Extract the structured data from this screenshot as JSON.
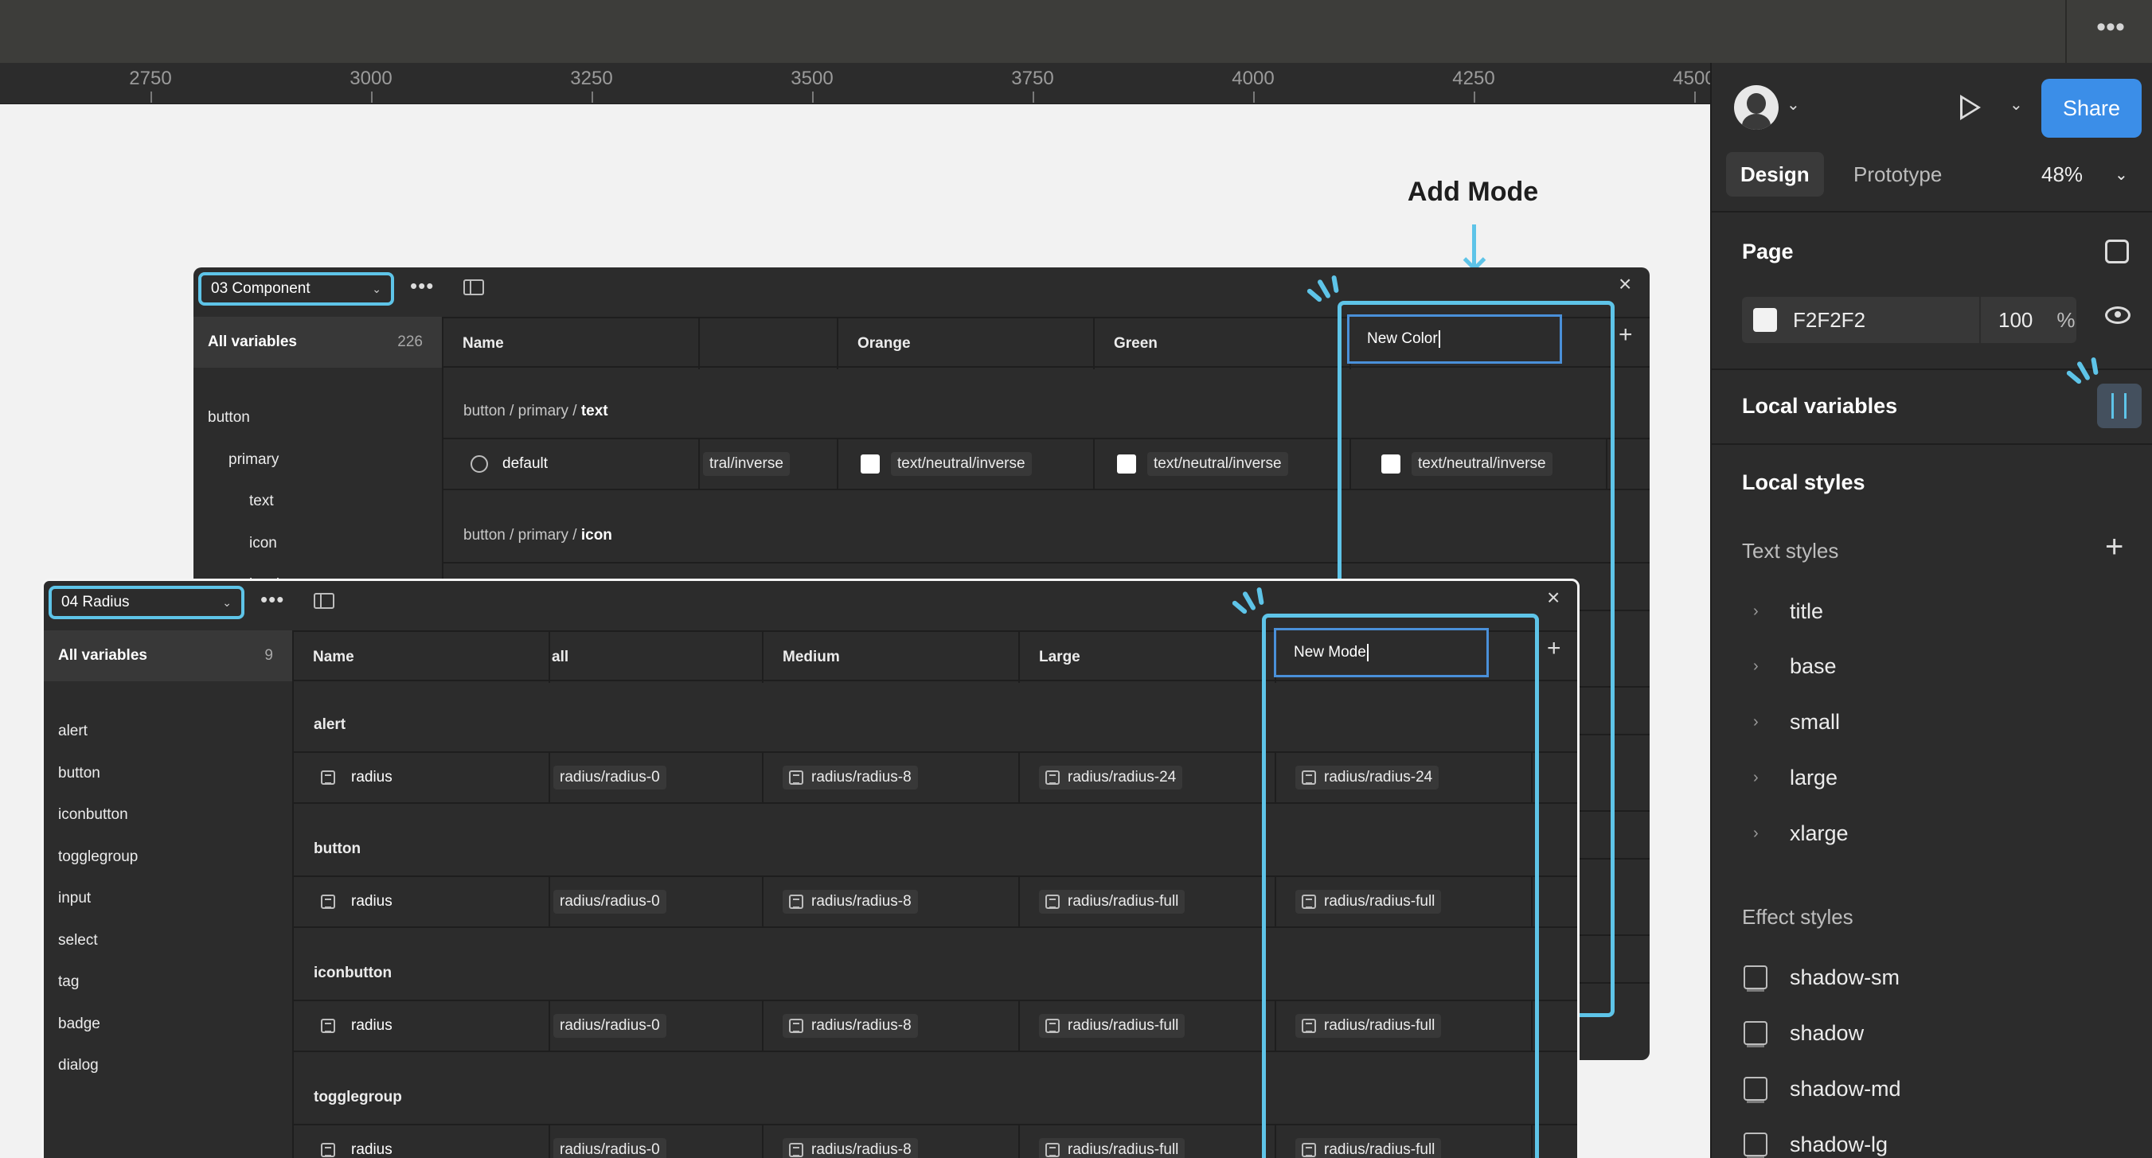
{
  "topbar": {
    "more_icon": "more-horizontal-icon"
  },
  "ruler": {
    "ticks": [
      "2750",
      "3000",
      "3250",
      "3500",
      "3750",
      "4000",
      "4250",
      "4500"
    ]
  },
  "annotation": {
    "add_mode": "Add Mode"
  },
  "panel_back": {
    "collection": "03 Component",
    "all_variables": "All variables",
    "count": "226",
    "groups": [
      "button",
      "primary",
      "text",
      "icon",
      "border"
    ],
    "headers": {
      "name": "Name",
      "col2": "Orange",
      "col3": "Green",
      "new_mode": "New Color"
    },
    "group1": {
      "prefix": "button / primary / ",
      "last": "text"
    },
    "row": {
      "name": "default",
      "col1": "tral/inverse",
      "col2": "text/neutral/inverse",
      "col3": "text/neutral/inverse",
      "col4": "text/neutral/inverse"
    },
    "group2": {
      "prefix": "button / primary / ",
      "last": "icon"
    }
  },
  "panel_front": {
    "collection": "04 Radius",
    "all_variables": "All variables",
    "count": "9",
    "groups": [
      "alert",
      "button",
      "iconbutton",
      "togglegroup",
      "input",
      "select",
      "tag",
      "badge",
      "dialog"
    ],
    "headers": {
      "name": "Name",
      "col1": "all",
      "col2": "Medium",
      "col3": "Large",
      "new_mode": "New Mode"
    },
    "sections": [
      {
        "label": "alert",
        "row": {
          "name": "radius",
          "c1": "radius/radius-0",
          "c2": "radius/radius-8",
          "c3": "radius/radius-24",
          "c4": "radius/radius-24"
        }
      },
      {
        "label": "button",
        "row": {
          "name": "radius",
          "c1": "radius/radius-0",
          "c2": "radius/radius-8",
          "c3": "radius/radius-full",
          "c4": "radius/radius-full"
        }
      },
      {
        "label": "iconbutton",
        "row": {
          "name": "radius",
          "c1": "radius/radius-0",
          "c2": "radius/radius-8",
          "c3": "radius/radius-full",
          "c4": "radius/radius-full"
        }
      },
      {
        "label": "togglegroup",
        "row": {
          "name": "radius",
          "c1": "radius/radius-0",
          "c2": "radius/radius-8",
          "c3": "radius/radius-full",
          "c4": "radius/radius-full"
        }
      }
    ]
  },
  "right_panel": {
    "share": "Share",
    "tabs": {
      "design": "Design",
      "prototype": "Prototype"
    },
    "zoom": "48%",
    "page": {
      "title": "Page",
      "color": "F2F2F2",
      "opacity": "100",
      "pct": "%"
    },
    "local_variables": "Local variables",
    "local_styles": "Local styles",
    "text_styles_title": "Text styles",
    "text_styles": [
      "title",
      "base",
      "small",
      "large",
      "xlarge"
    ],
    "effect_styles_title": "Effect styles",
    "effect_styles": [
      "shadow-sm",
      "shadow",
      "shadow-md",
      "shadow-lg"
    ]
  },
  "colors": {
    "accent": "#5ec4e8",
    "share": "#3b8ee8",
    "panel": "#2c2c2c",
    "canvas": "#f2f2f2"
  }
}
